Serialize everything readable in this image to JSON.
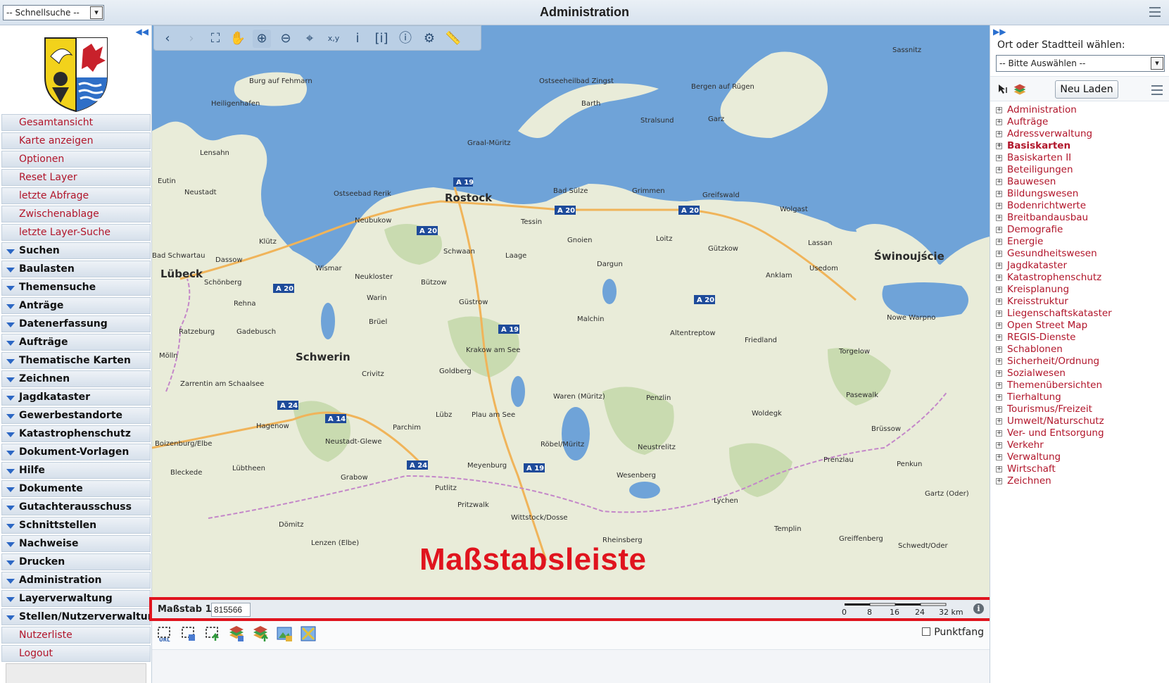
{
  "header": {
    "quicksearch_value": "-- Schnellsuche --",
    "title": "Administration"
  },
  "sidebar": {
    "items": [
      {
        "label": "Gesamtansicht",
        "type": "link"
      },
      {
        "label": "Karte anzeigen",
        "type": "link"
      },
      {
        "label": "Optionen",
        "type": "link"
      },
      {
        "label": "Reset Layer",
        "type": "link"
      },
      {
        "label": "letzte Abfrage",
        "type": "link"
      },
      {
        "label": "Zwischenablage",
        "type": "link"
      },
      {
        "label": "letzte Layer-Suche",
        "type": "link"
      },
      {
        "label": "Suchen",
        "type": "group"
      },
      {
        "label": "Baulasten",
        "type": "group"
      },
      {
        "label": "Themensuche",
        "type": "group"
      },
      {
        "label": "Anträge",
        "type": "group"
      },
      {
        "label": "Datenerfassung",
        "type": "group"
      },
      {
        "label": "Aufträge",
        "type": "group"
      },
      {
        "label": "Thematische Karten",
        "type": "group"
      },
      {
        "label": "Zeichnen",
        "type": "group"
      },
      {
        "label": "Jagdkataster",
        "type": "group"
      },
      {
        "label": "Gewerbestandorte",
        "type": "group"
      },
      {
        "label": "Katastrophenschutz",
        "type": "group"
      },
      {
        "label": "Dokument-Vorlagen",
        "type": "group"
      },
      {
        "label": "Hilfe",
        "type": "group"
      },
      {
        "label": "Dokumente Katasteramt",
        "type": "group"
      },
      {
        "label": "Gutachterausschuss",
        "type": "group"
      },
      {
        "label": "Schnittstellen",
        "type": "group"
      },
      {
        "label": "Nachweise",
        "type": "group"
      },
      {
        "label": "Drucken",
        "type": "group"
      },
      {
        "label": "Administration",
        "type": "group"
      },
      {
        "label": "Layerverwaltung",
        "type": "group"
      },
      {
        "label": "Stellen/Nutzerverwaltung",
        "type": "group"
      },
      {
        "label": "Nutzerliste",
        "type": "link"
      },
      {
        "label": "Logout",
        "type": "link"
      }
    ]
  },
  "map": {
    "annotation": "Maßstabsleiste",
    "places": [
      "Sassnitz",
      "Burg auf Fehmarn",
      "Ostseeheilbad Zingst",
      "Bergen auf Rügen",
      "Heiligenhafen",
      "Barth",
      "Garz",
      "Stralsund",
      "Graal-Müritz",
      "Lensahn",
      "Eutin",
      "Neustadt",
      "Ostseebad Rerik",
      "Rostock",
      "Bad Sülze",
      "Grimmen",
      "Greifswald",
      "Wolgast",
      "Neubukow",
      "Tessin",
      "Lassan",
      "Klütz",
      "Gnoien",
      "Loitz",
      "Gützkow",
      "Bad Schwartau",
      "Dassow",
      "Wismar",
      "Schwaan",
      "Laage",
      "Świnoujście",
      "Lübeck",
      "Neukloster",
      "Dargun",
      "Anklam",
      "Usedom",
      "Schönberg",
      "Bützow",
      "Rehna",
      "Warin",
      "Güstrow",
      "Ratzeburg",
      "Brüel",
      "Malchin",
      "Nowe Warpno",
      "Gadebusch",
      "Altentreptow",
      "Krakow am See",
      "Friedland",
      "Torgelow",
      "Mölln",
      "Schwerin",
      "Goldberg",
      "Crivitz",
      "Zarrentin am Schaalsee",
      "Pasewalk",
      "Waren (Müritz)",
      "Penzlin",
      "Lübz",
      "Woldegk",
      "Hagenow",
      "Parchim",
      "Plau am See",
      "Brüssow",
      "Boizenburg/Elbe",
      "Neustadt-Glewe",
      "Röbel/Müritz",
      "Neustrelitz",
      "Lübtheen",
      "Meyenburg",
      "Prenzlau",
      "Penkun",
      "Bleckede",
      "Grabow",
      "Wesenberg",
      "Putlitz",
      "Gartz (Oder)",
      "Pritzwalk",
      "Wittstock/Dosse",
      "Lychen",
      "Dömitz",
      "Templin",
      "Lenzen (Elbe)",
      "Greiffenberg",
      "Schwedt/Oder",
      "Rheinsberg"
    ],
    "roads": [
      "A 19",
      "A 20",
      "A 20",
      "A 20",
      "A 20",
      "A 20",
      "A 19",
      "A 24",
      "A 14",
      "A 24",
      "A 19"
    ]
  },
  "scalebar": {
    "label": "Maßstab 1:",
    "value": "815566",
    "ticks": [
      "0",
      "8",
      "16",
      "24",
      "32 km"
    ]
  },
  "bottom": {
    "punktfang_label": "Punktfang"
  },
  "right": {
    "place_label": "Ort oder Stadtteil wählen:",
    "place_select_value": "-- Bitte Auswählen --",
    "reload_label": "Neu Laden",
    "layers": [
      {
        "label": "Administration",
        "bold": false
      },
      {
        "label": "Aufträge",
        "bold": false
      },
      {
        "label": "Adressverwaltung",
        "bold": false
      },
      {
        "label": "Basiskarten",
        "bold": true
      },
      {
        "label": "Basiskarten II",
        "bold": false
      },
      {
        "label": "Beteiligungen",
        "bold": false
      },
      {
        "label": "Bauwesen",
        "bold": false
      },
      {
        "label": "Bildungswesen",
        "bold": false
      },
      {
        "label": "Bodenrichtwerte",
        "bold": false
      },
      {
        "label": "Breitbandausbau",
        "bold": false
      },
      {
        "label": "Demografie",
        "bold": false
      },
      {
        "label": "Energie",
        "bold": false
      },
      {
        "label": "Gesundheitswesen",
        "bold": false
      },
      {
        "label": "Jagdkataster",
        "bold": false
      },
      {
        "label": "Katastrophenschutz",
        "bold": false
      },
      {
        "label": "Kreisplanung",
        "bold": false
      },
      {
        "label": "Kreisstruktur",
        "bold": false
      },
      {
        "label": "Liegenschaftskataster",
        "bold": false
      },
      {
        "label": "Open Street Map",
        "bold": false
      },
      {
        "label": "REGIS-Dienste",
        "bold": false
      },
      {
        "label": "Schablonen",
        "bold": false
      },
      {
        "label": "Sicherheit/Ordnung",
        "bold": false
      },
      {
        "label": "Sozialwesen",
        "bold": false
      },
      {
        "label": "Themenübersichten",
        "bold": false
      },
      {
        "label": "Tierhaltung",
        "bold": false
      },
      {
        "label": "Tourismus/Freizeit",
        "bold": false
      },
      {
        "label": "Umwelt/Naturschutz",
        "bold": false
      },
      {
        "label": "Ver- und Entsorgung",
        "bold": false
      },
      {
        "label": "Verkehr",
        "bold": false
      },
      {
        "label": "Verwaltung",
        "bold": false
      },
      {
        "label": "Wirtschaft",
        "bold": false
      },
      {
        "label": "Zeichnen",
        "bold": false
      }
    ]
  },
  "colors": {
    "accent_red": "#e0141e",
    "link_red": "#b1152a",
    "sea": "#6fa3d8",
    "land": "#e9ecd9"
  }
}
